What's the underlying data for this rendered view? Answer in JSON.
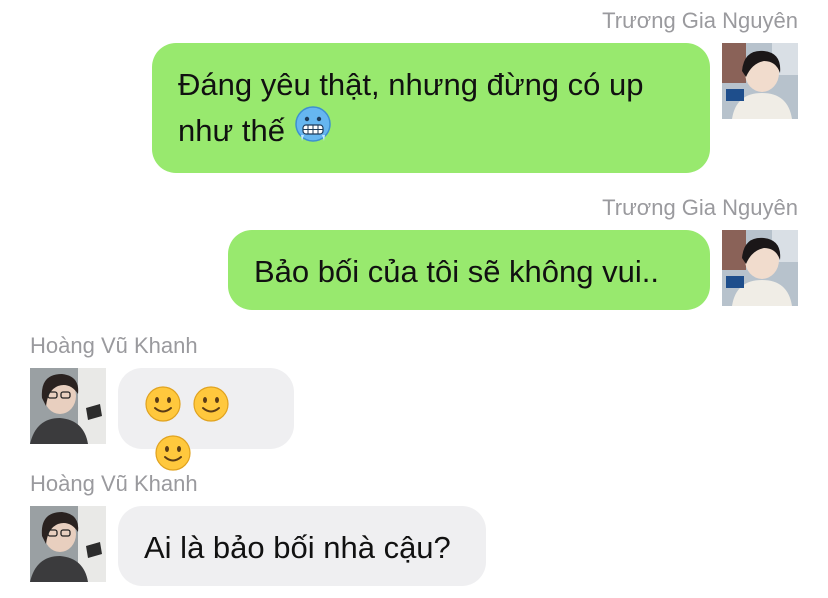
{
  "messages": [
    {
      "sender": "Trương Gia Nguyên",
      "line1": "Đáng yêu thật, nhưng đừng có up",
      "line2": "như thế",
      "emoji": "cold-face-emoji"
    },
    {
      "sender": "Trương Gia Nguyên",
      "text": "Bảo bối của tôi sẽ không vui.."
    },
    {
      "sender": "Hoàng Vũ Khanh",
      "emojis": [
        "slightly-smiling-face-emoji",
        "slightly-smiling-face-emoji",
        "slightly-smiling-face-emoji"
      ]
    },
    {
      "sender": "Hoàng Vũ Khanh",
      "text": "Ai là bảo bối nhà cậu?"
    }
  ],
  "colors": {
    "outgoing_bubble": "#98e96e",
    "incoming_bubble": "#efeff1",
    "sender_name": "#9a9a9e"
  }
}
